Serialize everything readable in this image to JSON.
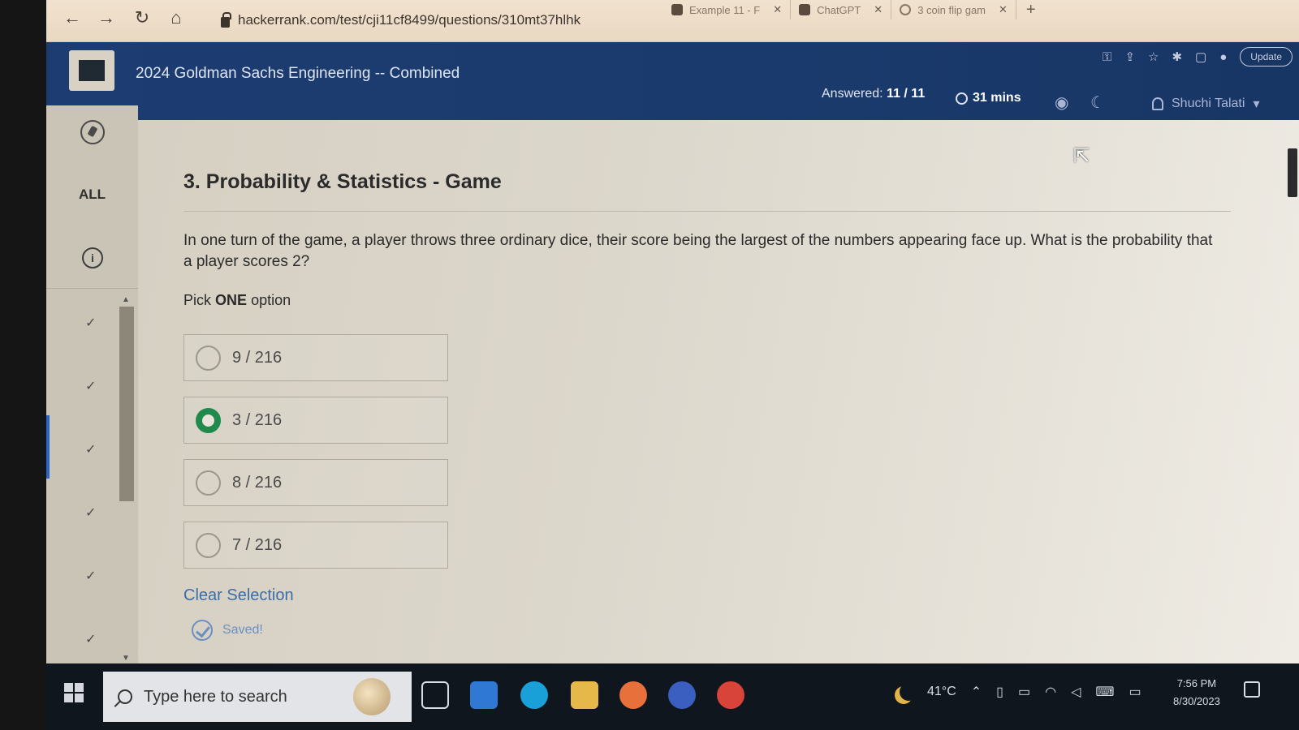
{
  "browser": {
    "url": "hackerrank.com/test/cji11cf8499/questions/310mt37hlhk",
    "tabs": [
      {
        "label": "Example 11 - F"
      },
      {
        "label": "ChatGPT"
      },
      {
        "label": "3 coin flip gam"
      }
    ],
    "update_label": "Update"
  },
  "header": {
    "test_title": "2024 Goldman Sachs Engineering -- Combined",
    "answered_label": "Answered:",
    "answered_value": "11 / 11",
    "timer": "31 mins",
    "user_name": "Shuchi Talati"
  },
  "sidebar": {
    "all_label": "ALL",
    "question_count": 6
  },
  "question": {
    "title": "3. Probability & Statistics - Game",
    "text": "In one turn of the game, a player throws three ordinary dice, their score being the largest of the numbers appearing face up. What is the probability that a player scores 2?",
    "pick_prefix": "Pick",
    "pick_bold": "ONE",
    "pick_suffix": "option",
    "options": [
      {
        "label": "9 / 216",
        "selected": false
      },
      {
        "label": "3 / 216",
        "selected": true
      },
      {
        "label": "8 / 216",
        "selected": false
      },
      {
        "label": "7 / 216",
        "selected": false
      }
    ],
    "clear_label": "Clear Selection",
    "saved_label": "Saved!"
  },
  "taskbar": {
    "search_placeholder": "Type here to search",
    "temperature": "41°C",
    "time": "7:56 PM",
    "date": "8/30/2023"
  },
  "colors": {
    "header_bg": "#1d3d72",
    "selected_radio": "#1f8a4c",
    "link": "#3b6ea8"
  }
}
